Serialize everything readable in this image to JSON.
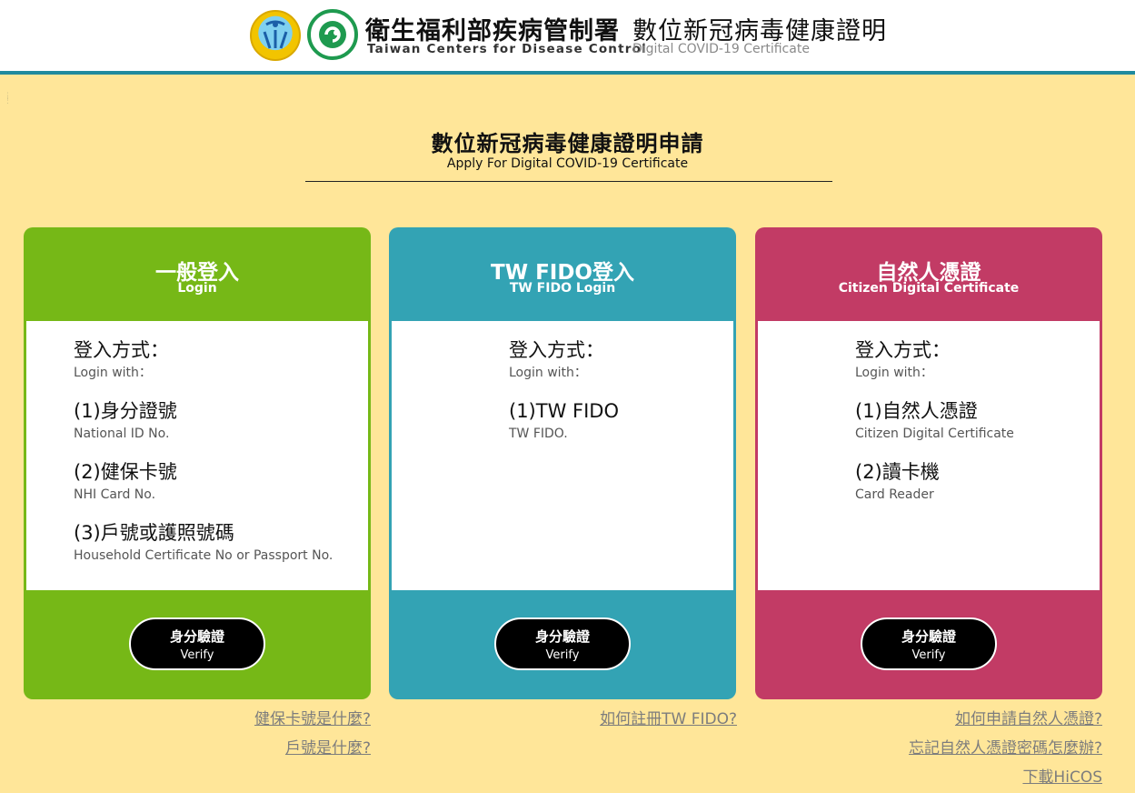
{
  "header": {
    "org_name_zh": "衛生福利部疾病管制署",
    "org_name_en": "Taiwan Centers for Disease Control",
    "cert_title_zh": "數位新冠病毒健康證明",
    "cert_title_en": "Digital COVID-19 Certificate"
  },
  "page": {
    "title_zh": "數位新冠病毒健康證明申請",
    "title_en": "Apply For Digital COVID-19 Certificate"
  },
  "cards": [
    {
      "title_zh": "一般登入",
      "title_en": "Login",
      "method_zh": "登入方式：",
      "method_en": "Login with：",
      "options": [
        {
          "zh": "(1)身分證號",
          "en": "National ID No."
        },
        {
          "zh": "(2)健保卡號",
          "en": "NHI Card No."
        },
        {
          "zh": "(3)戶號或護照號碼",
          "en": "Household Certificate No or Passport No."
        }
      ],
      "button_zh": "身分驗證",
      "button_en": "Verify",
      "links": [
        "健保卡號是什麼?",
        "戶號是什麼?"
      ]
    },
    {
      "title_zh": "TW FIDO登入",
      "title_en": "TW FIDO Login",
      "method_zh": "登入方式：",
      "method_en": "Login with：",
      "options": [
        {
          "zh": "(1)TW FIDO",
          "en": "TW FIDO."
        }
      ],
      "button_zh": "身分驗證",
      "button_en": "Verify",
      "links": [
        "如何註冊TW FIDO?"
      ]
    },
    {
      "title_zh": "自然人憑證",
      "title_en": "Citizen Digital Certificate",
      "method_zh": "登入方式：",
      "method_en": "Login with：",
      "options": [
        {
          "zh": "(1)自然人憑證",
          "en": "Citizen Digital Certificate"
        },
        {
          "zh": "(2)讀卡機",
          "en": "Card Reader"
        }
      ],
      "button_zh": "身分驗證",
      "button_en": "Verify",
      "links": [
        "如何申請自然人憑證?",
        "忘記自然人憑證密碼怎麼辦?",
        "下載HiCOS"
      ]
    }
  ],
  "colors": {
    "page_background": "#ffe699",
    "header_rule": "#1f8a9e",
    "card_general": "#76b817",
    "card_fido": "#33a3b4",
    "card_citizen": "#c23b65",
    "button": "#000000",
    "link": "#7d7d7d"
  },
  "icons": {
    "mohw_logo": "mohw-logo-icon",
    "cdc_logo": "cdc-logo-icon"
  }
}
